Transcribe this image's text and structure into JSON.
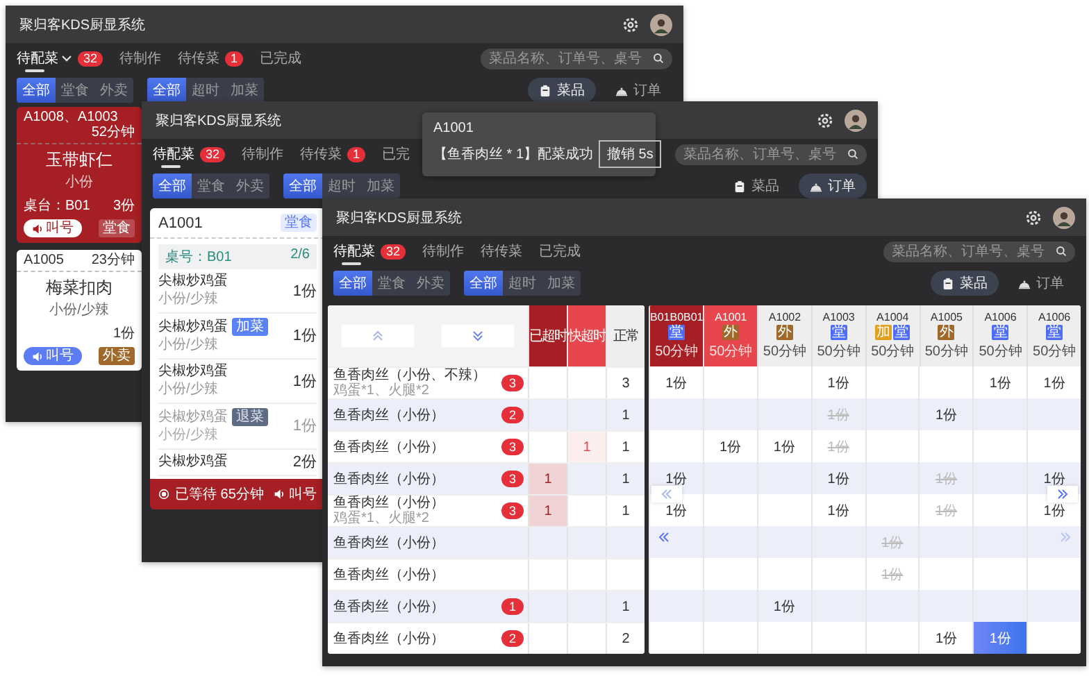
{
  "windows": [
    {
      "title": "聚归客KDS厨显系统",
      "tabs": [
        {
          "label": "待配菜",
          "badge": "32",
          "selected": true,
          "dropdown": true
        },
        {
          "label": "待制作",
          "selected": false,
          "dropdown": false
        },
        {
          "label": "待传菜",
          "badge": "1",
          "selected": false,
          "dropdown": false
        },
        {
          "label": "已完成",
          "selected": false,
          "dropdown": false
        }
      ],
      "search": {
        "placeholder": "菜品名称、订单号、桌号"
      },
      "filter_groups": [
        [
          {
            "label": "全部",
            "selected": true
          },
          {
            "label": "堂食",
            "selected": false
          },
          {
            "label": "外卖",
            "selected": false
          }
        ],
        [
          {
            "label": "全部",
            "selected": true
          },
          {
            "label": "超时",
            "selected": false
          },
          {
            "label": "加菜",
            "selected": false
          }
        ]
      ],
      "views": [
        {
          "label": "菜品",
          "kind": "dish",
          "selected": true
        },
        {
          "label": "订单",
          "kind": "order",
          "selected": false
        }
      ],
      "content": {
        "kind": "dish_cards",
        "cards": [
          {
            "overdue": true,
            "orders": "A1008、A1003",
            "elapsed": "52分钟",
            "dish": "玉带虾仁",
            "spec": "小份",
            "table": "桌台：B01",
            "quantity": "3份",
            "call": "叫号",
            "tag": {
              "kind": "dinein",
              "label": "堂食"
            }
          },
          {
            "overdue": false,
            "orders": "A1005",
            "elapsed": "23分钟",
            "dish": "梅菜扣肉",
            "spec": "小份/少辣",
            "quantity": "1份",
            "call": "叫号",
            "tag": {
              "kind": "takeout",
              "label": "外卖"
            }
          }
        ]
      }
    },
    {
      "title": "聚归客KDS厨显系统",
      "tabs": [
        {
          "label": "待配菜",
          "badge": "32",
          "selected": true,
          "dropdown": false
        },
        {
          "label": "待制作",
          "selected": false,
          "dropdown": false
        },
        {
          "label": "待传菜",
          "badge": "1",
          "selected": false,
          "dropdown": false
        },
        {
          "label": "已完",
          "selected": false,
          "dropdown": false
        }
      ],
      "search": {
        "placeholder": "菜品名称、订单号、桌号"
      },
      "filter_groups": [
        [
          {
            "label": "全部",
            "selected": true
          },
          {
            "label": "堂食",
            "selected": false
          },
          {
            "label": "外卖",
            "selected": false
          }
        ],
        [
          {
            "label": "全部",
            "selected": true
          },
          {
            "label": "超时",
            "selected": false
          },
          {
            "label": "加菜",
            "selected": false
          }
        ]
      ],
      "views": [
        {
          "label": "菜品",
          "kind": "dish",
          "selected": false
        },
        {
          "label": "订单",
          "kind": "order",
          "selected": true
        }
      ],
      "content": {
        "kind": "order_card",
        "order": "A1001",
        "tag": {
          "kind": "dinein",
          "label": "堂食"
        },
        "table": "桌号：B01",
        "progress": "2/6",
        "items": [
          {
            "name": "尖椒炒鸡蛋",
            "spec": "小份/少辣",
            "quantity": "1份",
            "done": false
          },
          {
            "name": "尖椒炒鸡蛋",
            "tag": {
              "kind": "added",
              "label": "加菜"
            },
            "spec": "小份/少辣",
            "quantity": "1份",
            "done": false
          },
          {
            "name": "尖椒炒鸡蛋",
            "spec": "小份/少辣",
            "quantity": "1份",
            "done": false
          },
          {
            "name": "尖椒炒鸡蛋",
            "tag": {
              "kind": "returned",
              "label": "退菜"
            },
            "spec": "小份/少辣",
            "quantity": "1份",
            "done": true
          },
          {
            "name": "尖椒炒鸡蛋",
            "quantity": "2份",
            "done": false
          }
        ],
        "wait": "已等待 65分钟",
        "call": "叫号"
      },
      "toast": {
        "title": "A1001",
        "message": "【鱼香肉丝 * 1】配菜成功",
        "action": "撤销 5s"
      }
    },
    {
      "title": "聚归客KDS厨显系统",
      "tabs": [
        {
          "label": "待配菜",
          "badge": "32",
          "selected": true,
          "dropdown": false
        },
        {
          "label": "待制作",
          "selected": false,
          "dropdown": false
        },
        {
          "label": "待传菜",
          "selected": false,
          "dropdown": false
        },
        {
          "label": "已完成",
          "selected": false,
          "dropdown": false
        }
      ],
      "search": {
        "placeholder": "菜品名称、订单号、桌号"
      },
      "filter_groups": [
        [
          {
            "label": "全部",
            "selected": true
          },
          {
            "label": "堂食",
            "selected": false
          },
          {
            "label": "外卖",
            "selected": false
          }
        ],
        [
          {
            "label": "全部",
            "selected": true
          },
          {
            "label": "超时",
            "selected": false
          },
          {
            "label": "加菜",
            "selected": false
          }
        ]
      ],
      "views": [
        {
          "label": "菜品",
          "kind": "dish",
          "selected": true
        },
        {
          "label": "订单",
          "kind": "order",
          "selected": false
        }
      ],
      "content": {
        "kind": "dish_grid",
        "status_columns": [
          {
            "label": "已超时",
            "kind": "overdue"
          },
          {
            "label": "快超时",
            "kind": "near"
          },
          {
            "label": "正常",
            "kind": "normal"
          }
        ],
        "orders": [
          {
            "label": "B01B0B01",
            "kind": "overdue",
            "tags": [
              {
                "kind": "dinein",
                "label": "堂"
              }
            ],
            "elapsed": "50分钟"
          },
          {
            "label": "A1001",
            "kind": "near",
            "tags": [
              {
                "kind": "takeout",
                "label": "外"
              }
            ],
            "elapsed": "50分钟"
          },
          {
            "label": "A1002",
            "kind": "normal",
            "tags": [
              {
                "kind": "takeout",
                "label": "外"
              }
            ],
            "elapsed": "50分钟"
          },
          {
            "label": "A1003",
            "kind": "normal",
            "tags": [
              {
                "kind": "dinein",
                "label": "堂"
              }
            ],
            "elapsed": "50分钟"
          },
          {
            "label": "A1004",
            "kind": "normal",
            "tags": [
              {
                "kind": "added",
                "label": "加"
              },
              {
                "kind": "dinein",
                "label": "堂"
              }
            ],
            "elapsed": "50分钟"
          },
          {
            "label": "A1005",
            "kind": "normal",
            "tags": [
              {
                "kind": "takeout",
                "label": "外"
              }
            ],
            "elapsed": "50分钟"
          },
          {
            "label": "A1006",
            "kind": "normal",
            "tags": [
              {
                "kind": "dinein",
                "label": "堂"
              }
            ],
            "elapsed": "50分钟"
          },
          {
            "label": "A1006",
            "kind": "normal",
            "tags": [
              {
                "kind": "dinein",
                "label": "堂"
              }
            ],
            "elapsed": "50分钟"
          }
        ],
        "rows": [
          {
            "dish": "鱼香肉丝（小份、不辣）",
            "extras": "鸡蛋*1、火腿*2",
            "count": "3",
            "status_counts": {
              "normal": "3"
            },
            "cells": [
              {
                "text": "1份",
                "done": false,
                "selected": false
              },
              null,
              null,
              {
                "text": "1份",
                "done": false,
                "selected": false
              },
              null,
              null,
              {
                "text": "1份",
                "done": false,
                "selected": false
              },
              {
                "text": "1份",
                "done": false,
                "selected": false
              }
            ]
          },
          {
            "dish": "鱼香肉丝（小份）",
            "count": "2",
            "status_counts": {
              "normal": "1"
            },
            "cells": [
              null,
              null,
              null,
              {
                "text": "1份",
                "done": true,
                "selected": false
              },
              null,
              {
                "text": "1份",
                "done": false,
                "selected": false
              },
              null,
              null
            ]
          },
          {
            "dish": "鱼香肉丝（小份）",
            "count": "3",
            "status_counts": {
              "near": "1",
              "normal": "1"
            },
            "cells": [
              null,
              {
                "text": "1份",
                "done": false,
                "selected": false
              },
              {
                "text": "1份",
                "done": false,
                "selected": false
              },
              {
                "text": "1份",
                "done": true,
                "selected": false
              },
              null,
              null,
              null,
              null
            ]
          },
          {
            "dish": "鱼香肉丝（小份）",
            "count": "3",
            "status_counts": {
              "overdue": "1",
              "normal": "1"
            },
            "cells": [
              {
                "text": "1份",
                "done": false,
                "selected": false
              },
              null,
              null,
              {
                "text": "1份",
                "done": false,
                "selected": false
              },
              null,
              {
                "text": "1份",
                "done": true,
                "selected": false
              },
              null,
              {
                "text": "1份",
                "done": false,
                "selected": false
              }
            ]
          },
          {
            "dish": "鱼香肉丝（小份）",
            "extras": "鸡蛋*1、火腿*2",
            "count": "3",
            "status_counts": {
              "overdue": "1",
              "normal": "1"
            },
            "cells": [
              {
                "text": "1份",
                "done": false,
                "selected": false
              },
              null,
              null,
              {
                "text": "1份",
                "done": false,
                "selected": false
              },
              null,
              {
                "text": "1份",
                "done": true,
                "selected": false
              },
              null,
              {
                "text": "1份",
                "done": false,
                "selected": false
              }
            ]
          },
          {
            "dish": "鱼香肉丝（小份）",
            "cells": [
              null,
              null,
              null,
              null,
              {
                "text": "1份",
                "done": true,
                "selected": false
              },
              null,
              null,
              null
            ]
          },
          {
            "dish": "鱼香肉丝（小份）",
            "cells": [
              null,
              null,
              null,
              null,
              {
                "text": "1份",
                "done": true,
                "selected": false
              },
              null,
              null,
              null
            ]
          },
          {
            "dish": "鱼香肉丝（小份）",
            "count": "1",
            "status_counts": {
              "normal": "1"
            },
            "cells": [
              null,
              null,
              {
                "text": "1份",
                "done": false,
                "selected": false
              },
              null,
              null,
              null,
              null,
              null
            ]
          },
          {
            "dish": "鱼香肉丝（小份）",
            "count": "2",
            "status_counts": {
              "normal": "2"
            },
            "cells": [
              null,
              null,
              null,
              null,
              null,
              {
                "text": "1份",
                "done": false,
                "selected": false
              },
              {
                "text": "1份",
                "done": false,
                "selected": true
              },
              null
            ]
          }
        ]
      }
    }
  ]
}
